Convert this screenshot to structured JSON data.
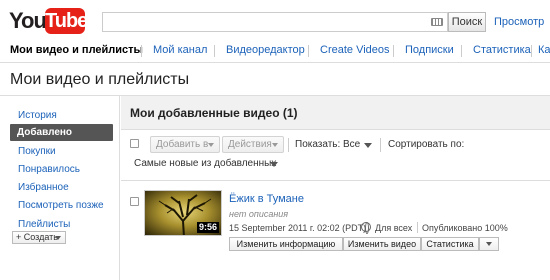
{
  "header": {
    "logo_you": "You",
    "logo_tube": "Tube",
    "search_value": "",
    "search_button": "Поиск",
    "browse_link": "Просмотр"
  },
  "topnav": {
    "items": [
      {
        "label": "Мои видео и плейлисты",
        "active": true
      },
      {
        "label": "Мой канал",
        "active": false
      },
      {
        "label": "Видеоредактор",
        "active": false
      },
      {
        "label": "Create Videos",
        "active": false
      },
      {
        "label": "Подписки",
        "active": false
      },
      {
        "label": "Статистика",
        "active": false
      },
      {
        "label": "Ка",
        "active": false
      }
    ]
  },
  "page_title": "Мои видео и плейлисты",
  "sidebar": {
    "items": [
      {
        "label": "История",
        "active": false
      },
      {
        "label": "Добавлено",
        "active": true
      },
      {
        "label": "Покупки",
        "active": false
      },
      {
        "label": "Понравилось",
        "active": false
      },
      {
        "label": "Избранное",
        "active": false
      },
      {
        "label": "Посмотреть позже",
        "active": false
      },
      {
        "label": "Плейлисты",
        "active": false
      }
    ],
    "create_button": "+ Создать"
  },
  "main": {
    "title": "Мои добавленные видео (1)",
    "toolbar": {
      "add_to": "Добавить в",
      "actions": "Действия",
      "show_label": "Показать:",
      "show_value": "Все",
      "sort_label": "Сортировать по:",
      "sort_value": "Самые новые из добавленных"
    },
    "videos": [
      {
        "title": "Ёжик в Тумане",
        "description": "нет описания",
        "date": "15 September 2011 г. 02:02 (PDT)",
        "privacy": "Для всех",
        "status": "Опубликовано 100%",
        "duration": "9:56",
        "buttons": {
          "edit_info": "Изменить информацию",
          "edit_video": "Изменить видео",
          "stats": "Статистика"
        }
      }
    ]
  },
  "colors": {
    "link": "#1c62b9",
    "logo_red": "#e62117",
    "active_sidebar": "#555555"
  }
}
